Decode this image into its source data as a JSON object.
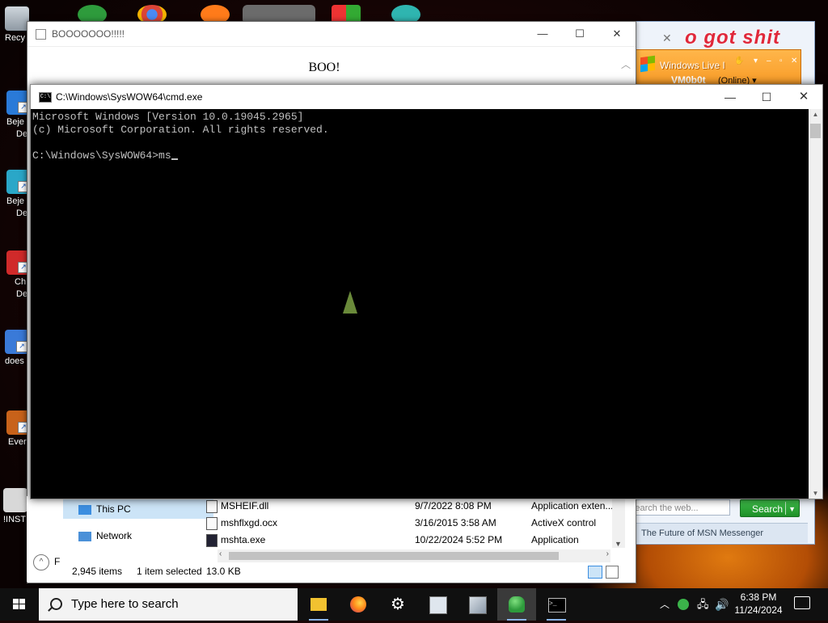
{
  "desktop": {
    "icons": [
      {
        "label": "Recy",
        "name": "recycle-bin"
      },
      {
        "label": "Beje",
        "label2": "De",
        "name": "bejeweled-deluxe-1"
      },
      {
        "label": "Beje",
        "label2": "De",
        "name": "bejeweled-deluxe-2"
      },
      {
        "label": "Ch",
        "label2": "De",
        "name": "chuzzle-deluxe"
      },
      {
        "label": "does",
        "name": "does-shortcut"
      },
      {
        "label": "Ever",
        "name": "ever-shortcut"
      },
      {
        "label": "!INST",
        "name": "install-shortcut"
      }
    ]
  },
  "boo_window": {
    "title": "BOOOOOOO!!!!!",
    "message": "BOO!"
  },
  "msn": {
    "title": "Windows Live I",
    "user": "VM0b0t",
    "status": "(Online) ▾",
    "banner": "o got shit",
    "search_placeholder": "Search the web...",
    "search_label": "Search",
    "footer": "The Future of MSN Messenger"
  },
  "cmd": {
    "title": "C:\\Windows\\SysWOW64\\cmd.exe",
    "line1": "Microsoft Windows [Version 10.0.19045.2965]",
    "line2": "(c) Microsoft Corporation. All rights reserved.",
    "prompt": "C:\\Windows\\SysWOW64>ms"
  },
  "explorer": {
    "nav": [
      {
        "label": "This PC",
        "selected": true
      },
      {
        "label": "Network",
        "selected": false
      }
    ],
    "files": [
      {
        "name": "MSHEIF.dll",
        "date": "9/7/2022 8:08 PM",
        "type": "Application exten..."
      },
      {
        "name": "mshflxgd.ocx",
        "date": "3/16/2015 3:58 AM",
        "type": "ActiveX control"
      },
      {
        "name": "mshta.exe",
        "date": "10/22/2024 5:52 PM",
        "type": "Application"
      }
    ],
    "status_items": "2,945 items",
    "status_selected": "1 item selected",
    "status_size": "13.0 KB",
    "left_f": "F"
  },
  "taskbar": {
    "search_placeholder": "Type here to search",
    "apps": [
      {
        "name": "file-explorer-icon",
        "color": "#f2c230",
        "running": true
      },
      {
        "name": "firefox-icon",
        "color": "#ff6a1a",
        "running": false
      },
      {
        "name": "settings-gear-icon",
        "color": "#ffffff",
        "running": false
      },
      {
        "name": "app-window-icon",
        "color": "#9ab0c8",
        "running": false
      },
      {
        "name": "image-viewer-icon",
        "color": "#c8d0d8",
        "running": false
      },
      {
        "name": "msn-messenger-icon",
        "color": "#3bb34a",
        "running": true,
        "active": true
      },
      {
        "name": "command-prompt-icon",
        "color": "#cccccc",
        "running": true
      }
    ],
    "time": "6:38 PM",
    "date": "11/24/2024"
  }
}
